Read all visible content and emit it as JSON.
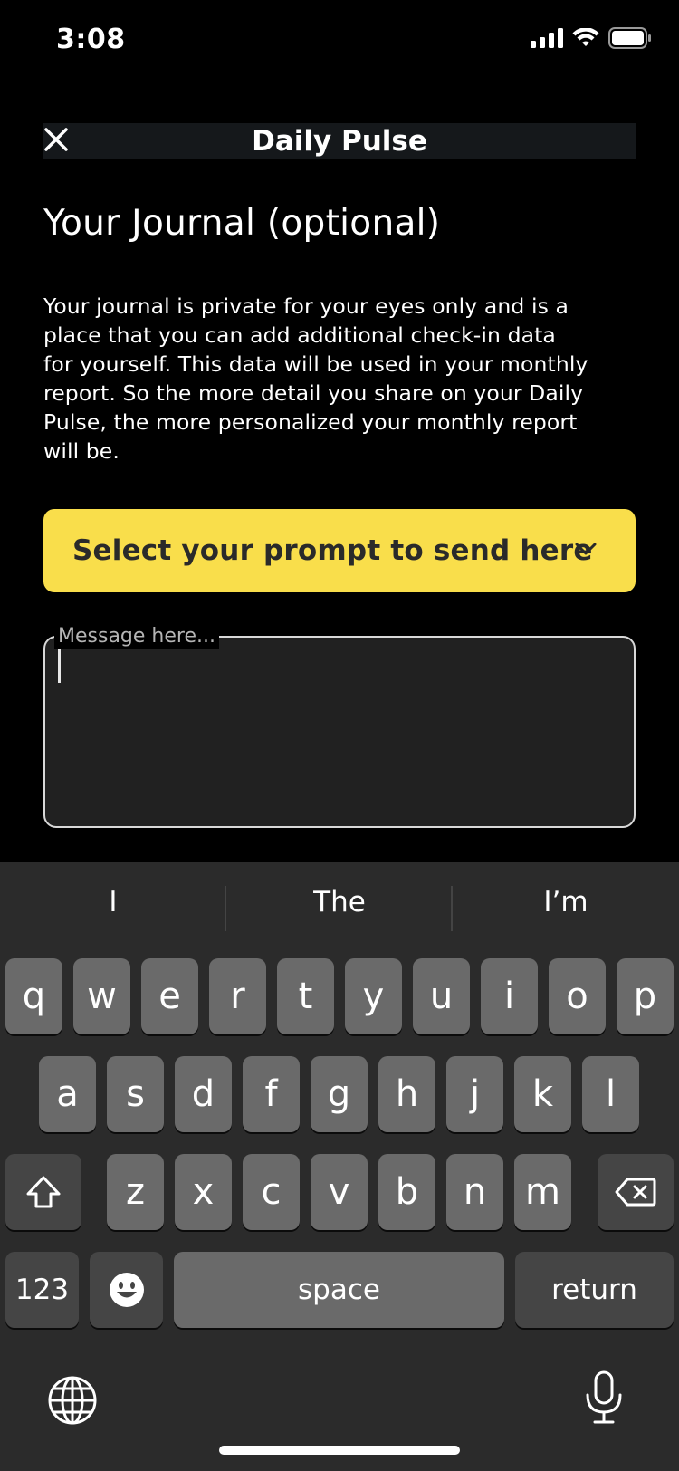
{
  "status_bar": {
    "time": "3:08"
  },
  "header": {
    "title": "Daily Pulse"
  },
  "page": {
    "title": "Your Journal (optional)",
    "description_lines": [
      "Your journal is private for your eyes only and is a",
      "place that you can add additional check-in data",
      "for yourself.  This data will be used in your monthly",
      "report.  So the more detail you share on your Daily",
      "Pulse, the more personalized your monthly report",
      "will be."
    ]
  },
  "prompt_select": {
    "label": "Select your prompt to send here"
  },
  "message": {
    "placeholder": "Message here...",
    "value": ""
  },
  "keyboard": {
    "suggestions": [
      "I",
      "The",
      "I’m"
    ],
    "row1": [
      "q",
      "w",
      "e",
      "r",
      "t",
      "y",
      "u",
      "i",
      "o",
      "p"
    ],
    "row2": [
      "a",
      "s",
      "d",
      "f",
      "g",
      "h",
      "j",
      "k",
      "l"
    ],
    "row3": [
      "z",
      "x",
      "c",
      "v",
      "b",
      "n",
      "m"
    ],
    "numbers_label": "123",
    "space_label": "space",
    "return_label": "return"
  },
  "colors": {
    "accent": "#f9de4b",
    "background": "#000000",
    "keyboard": "#2b2b2b"
  },
  "icons": [
    "signal-icon",
    "wifi-icon",
    "battery-icon",
    "close-icon",
    "chevron-down-icon",
    "shift-icon",
    "backspace-icon",
    "emoji-icon",
    "globe-icon",
    "microphone-icon"
  ]
}
